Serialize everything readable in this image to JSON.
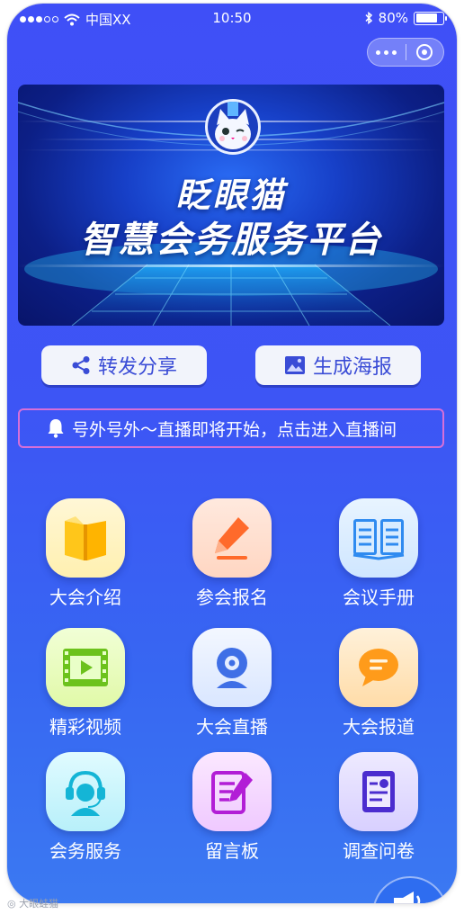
{
  "status_bar": {
    "carrier": "中国XX",
    "time": "10:50",
    "battery": "80%",
    "battery_level": 0.8
  },
  "capsule": {
    "more_icon": "more-dots-icon",
    "close_icon": "target-circle-icon"
  },
  "banner": {
    "line1": "眨眼猫",
    "line2": "智慧会务服务平台"
  },
  "actions": {
    "share_label": "转发分享",
    "poster_label": "生成海报"
  },
  "notice": {
    "text": "号外号外～直播即将开始，点击进入直播间"
  },
  "grid": [
    {
      "label": "大会介绍",
      "icon": "book-icon"
    },
    {
      "label": "参会报名",
      "icon": "pen-icon"
    },
    {
      "label": "会议手册",
      "icon": "open-book-icon"
    },
    {
      "label": "精彩视频",
      "icon": "video-icon"
    },
    {
      "label": "大会直播",
      "icon": "webcam-icon"
    },
    {
      "label": "大会报道",
      "icon": "chat-bubble-icon"
    },
    {
      "label": "会务服务",
      "icon": "headset-icon"
    },
    {
      "label": "留言板",
      "icon": "note-edit-icon"
    },
    {
      "label": "调查问卷",
      "icon": "questionnaire-icon"
    }
  ],
  "colors": {
    "background": "#3d55f5",
    "notice_border": "#d66fd8",
    "button_text": "#3a4cd6"
  }
}
